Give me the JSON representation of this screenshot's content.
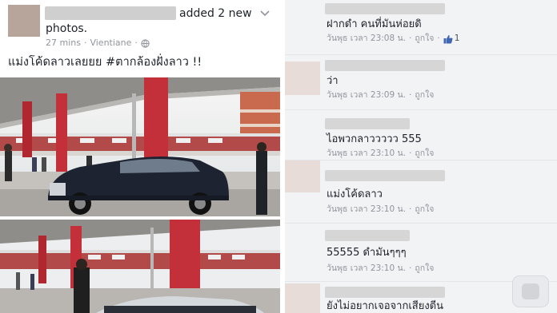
{
  "post": {
    "added_text": "added 2 new",
    "photos_text": "photos.",
    "time": "27 mins",
    "separator": "·",
    "location": "Vientiane",
    "separator2": "·",
    "caption": "แม่งโค้ดลาวเลยยย #ตากล้องฝั่งลาว !!"
  },
  "comments": [
    {
      "text": "ฝากดำ คนที่มันห่อยดิ",
      "time": "วันพุธ เวลา 23:08 น.",
      "dot": "·",
      "like": "ถูกใจ",
      "dot2": "·",
      "like_count": "1"
    },
    {
      "text": "ว่า",
      "time": "วันพุธ เวลา 23:09 น.",
      "dot": "·",
      "like": "ถูกใจ"
    },
    {
      "text": "ไอพวกลาววววว 555",
      "time": "วันพุธ เวลา 23:10 น.",
      "dot": "·",
      "like": "ถูกใจ"
    },
    {
      "text": "แม่งโค้ดลาว",
      "time": "วันพุธ เวลา 23:10 น.",
      "dot": "·",
      "like": "ถูกใจ"
    },
    {
      "text": "55555 ดำมันๆๆๆ",
      "time": "วันพุธ เวลา 23:10 น.",
      "dot": "·",
      "like": "ถูกใจ"
    },
    {
      "text": "ยังไม่อยากเจอจากเสียงตีน"
    }
  ],
  "colors": {
    "background_right": "#f2f3f5",
    "meta_text": "#90949c",
    "link_blue": "#4267b2",
    "pillar_red": "#c4303a"
  },
  "icons": [
    "chevron-down-icon",
    "globe-icon",
    "thumbs-up-icon",
    "chat-bubble-icon"
  ]
}
